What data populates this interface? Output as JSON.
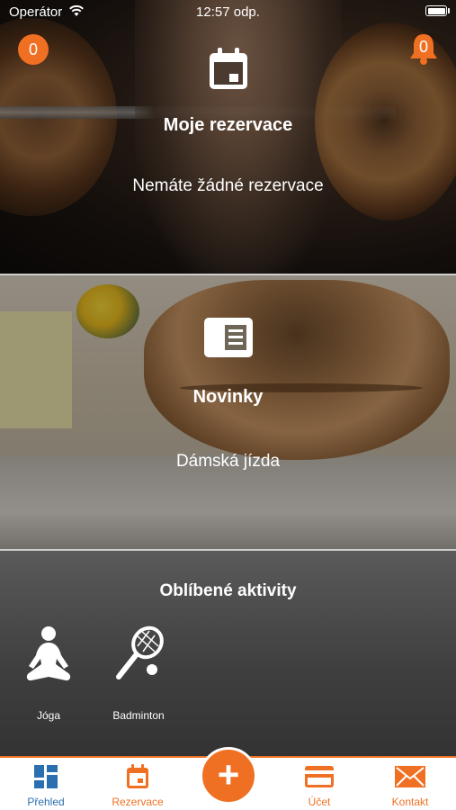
{
  "status_bar": {
    "carrier": "Operátor",
    "time": "12:57 odp."
  },
  "header": {
    "left_badge_count": "0",
    "notification_count": "0"
  },
  "reservations": {
    "title": "Moje rezervace",
    "text": "Nemáte žádné rezervace",
    "icon": "calendar-icon"
  },
  "news": {
    "title": "Novinky",
    "text": "Dámská jízda",
    "icon": "newspaper-icon"
  },
  "favorites": {
    "title": "Oblíbené aktivity",
    "items": [
      {
        "label": "Jóga",
        "icon": "yoga-icon"
      },
      {
        "label": "Badminton",
        "icon": "racket-icon"
      }
    ]
  },
  "tabbar": {
    "items": [
      {
        "label": "Přehled",
        "icon": "dashboard-icon",
        "active": true
      },
      {
        "label": "Rezervace",
        "icon": "calendar-icon",
        "active": false
      },
      {
        "label": "Účet",
        "icon": "credit-card-icon",
        "active": false
      },
      {
        "label": "Kontakt",
        "icon": "envelope-icon",
        "active": false
      }
    ],
    "center_button": "+"
  },
  "colors": {
    "accent": "#f07023",
    "active_tab": "#2a6fb0"
  }
}
